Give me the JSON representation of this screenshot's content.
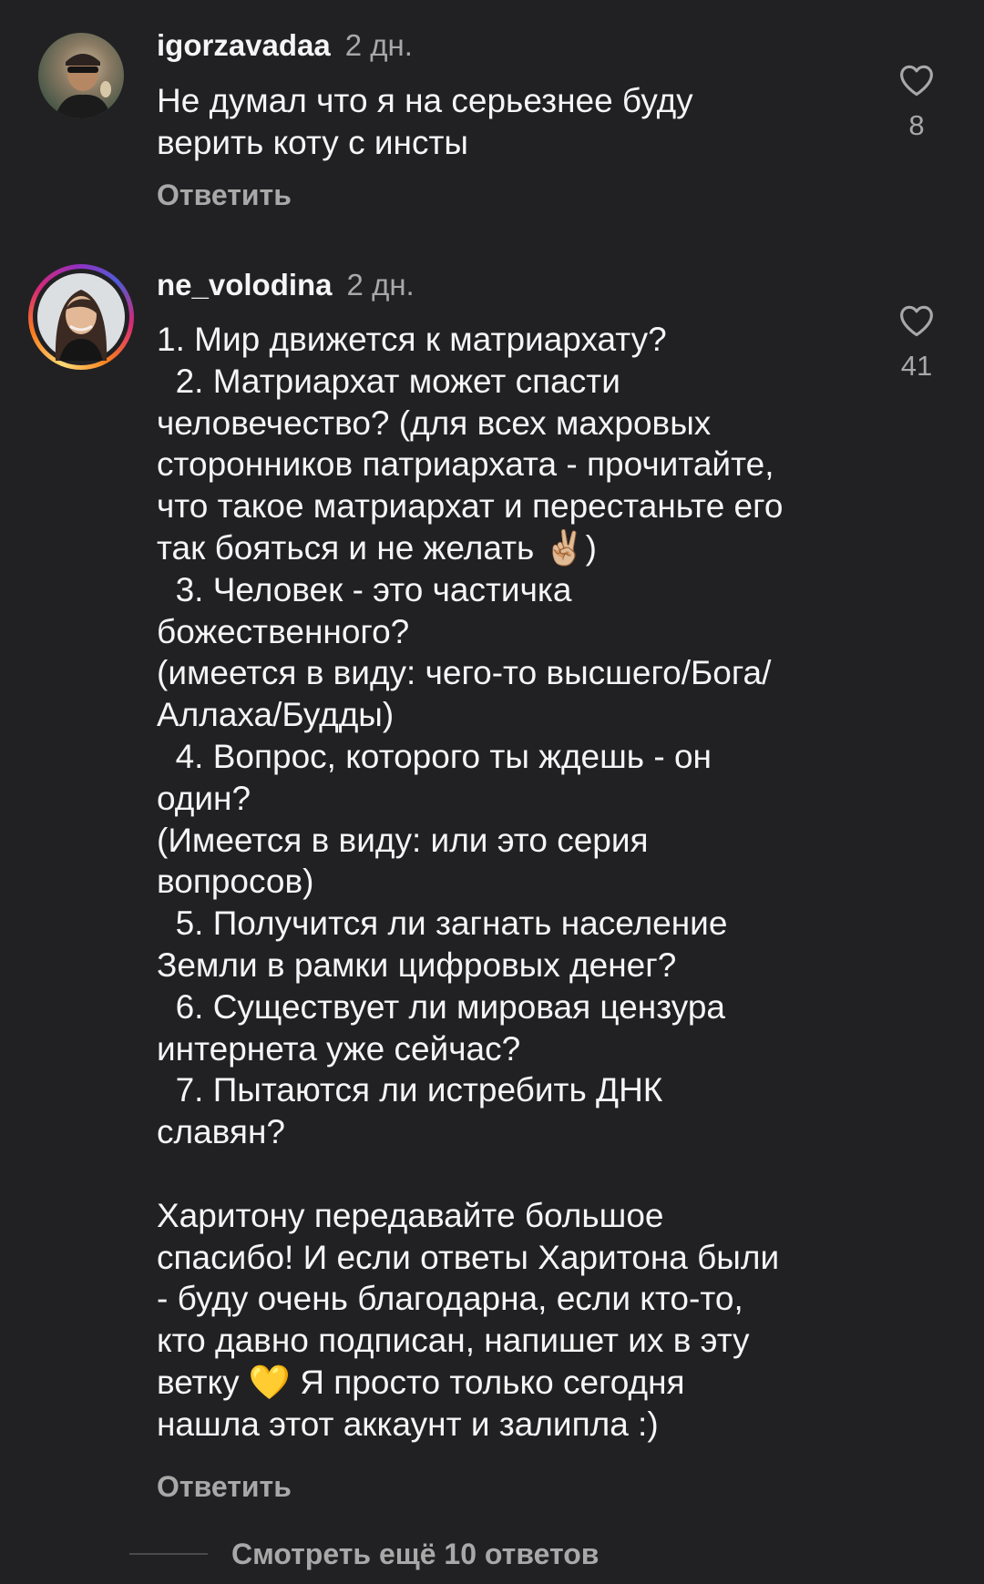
{
  "comments": [
    {
      "username": "igorzavadaa",
      "time": "2 дн.",
      "text": "Не думал что я на серьезнее буду\nверить коту с инсты",
      "likes": "8",
      "reply_label": "Ответить"
    },
    {
      "username": "ne_volodina",
      "time": "2 дн.",
      "text": "1. Мир движется к матриархату?\n  2. Матриархат может спасти\nчеловечество? (для всех махровых\nсторонников патриархата - прочитайте,\nчто такое матриархат и перестаньте его\nтак бояться и не желать ✌🏼)\n  3. Человек - это частичка\nбожественного?\n(имеется в виду: чего-то высшего/Бога/\nАллаха/Будды)\n  4. Вопрос, которого ты ждешь - он\nодин?\n(Имеется в виду: или это серия\nвопросов)\n  5. Получится ли загнать население\nЗемли в рамки цифровых денег?\n  6. Существует ли мировая цензура\nинтернета уже сейчас?\n  7. Пытаются ли истребить ДНК\nславян?\n\nХаритону передавайте большое\nспасибо! И если ответы Харитона были\n- буду очень благодарна, если кто-то,\nкто давно подписан, напишет их в эту\nветку 💛 Я просто только сегодня\nнашла этот аккаунт и залипла :)",
      "likes": "41",
      "reply_label": "Ответить"
    }
  ],
  "more_replies_label": "Смотреть ещё 10 ответов",
  "icons": {
    "like": "heart-outline-icon"
  },
  "colors": {
    "background": "#212124",
    "primary_text": "#f5f5f5",
    "secondary_text": "#a8a8a8"
  }
}
